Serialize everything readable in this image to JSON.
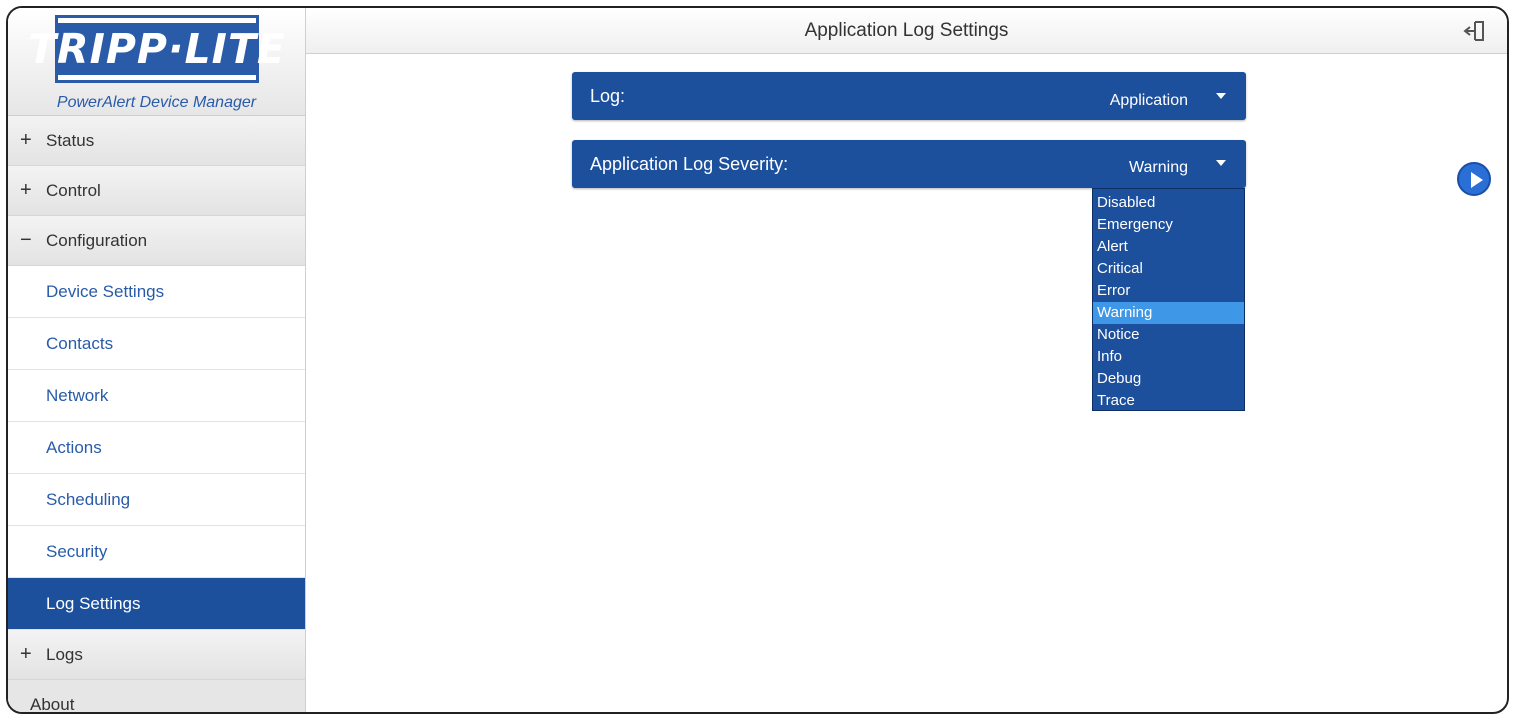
{
  "brand": {
    "logo": "TRIPP·LITE",
    "subtitle": "PowerAlert Device Manager"
  },
  "header": {
    "title": "Application Log Settings"
  },
  "sidebar": {
    "status": {
      "sign": "+",
      "label": "Status"
    },
    "control": {
      "sign": "+",
      "label": "Control"
    },
    "configuration": {
      "sign": "−",
      "label": "Configuration"
    },
    "sub_items": [
      {
        "label": "Device Settings"
      },
      {
        "label": "Contacts"
      },
      {
        "label": "Network"
      },
      {
        "label": "Actions"
      },
      {
        "label": "Scheduling"
      },
      {
        "label": "Security"
      },
      {
        "label": "Log Settings"
      }
    ],
    "logs": {
      "sign": "+",
      "label": "Logs"
    },
    "about": {
      "label": "About"
    }
  },
  "form": {
    "log": {
      "label": "Log:",
      "value": "Application"
    },
    "severity": {
      "label": "Application Log Severity:",
      "value": "Warning",
      "options": [
        "Disabled",
        "Emergency",
        "Alert",
        "Critical",
        "Error",
        "Warning",
        "Notice",
        "Info",
        "Debug",
        "Trace"
      ]
    }
  },
  "colors": {
    "accent": "#1c4f9c",
    "selected_option": "#3f97e8",
    "link": "#2a5ba8"
  },
  "icons": {
    "logout": "logout-icon",
    "next": "play-circle-icon"
  }
}
